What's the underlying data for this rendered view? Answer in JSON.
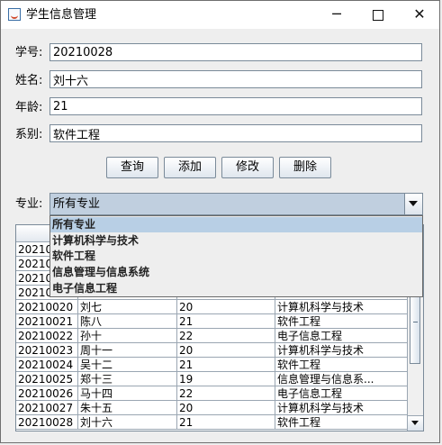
{
  "window": {
    "title": "学生信息管理",
    "minimize": "─"
  },
  "form": {
    "id_label": "学号:",
    "id_value": "20210028",
    "name_label": "姓名:",
    "name_value": "刘十六",
    "age_label": "年龄:",
    "age_value": "21",
    "dept_label": "系别:",
    "dept_value": "软件工程"
  },
  "buttons": {
    "query": "查询",
    "add": "添加",
    "modify": "修改",
    "delete": "删除"
  },
  "major": {
    "label": "专业:",
    "selected": "所有专业",
    "options": [
      "所有专业",
      "计算机科学与技术",
      "软件工程",
      "信息管理与信息系统",
      "电子信息工程"
    ]
  },
  "table": {
    "hidden_rows": [
      "2021001",
      "2021001",
      "2021001",
      "2021001"
    ],
    "rows": [
      [
        "20210020",
        "刘七",
        "20",
        "计算机科学与技术"
      ],
      [
        "20210021",
        "陈八",
        "21",
        "软件工程"
      ],
      [
        "20210022",
        "孙十",
        "22",
        "电子信息工程"
      ],
      [
        "20210023",
        "周十一",
        "20",
        "计算机科学与技术"
      ],
      [
        "20210024",
        "吴十二",
        "21",
        "软件工程"
      ],
      [
        "20210025",
        "郑十三",
        "19",
        "信息管理与信息系..."
      ],
      [
        "20210026",
        "马十四",
        "22",
        "电子信息工程"
      ],
      [
        "20210027",
        "朱十五",
        "20",
        "计算机科学与技术"
      ],
      [
        "20210028",
        "刘十六",
        "21",
        "软件工程"
      ]
    ]
  }
}
